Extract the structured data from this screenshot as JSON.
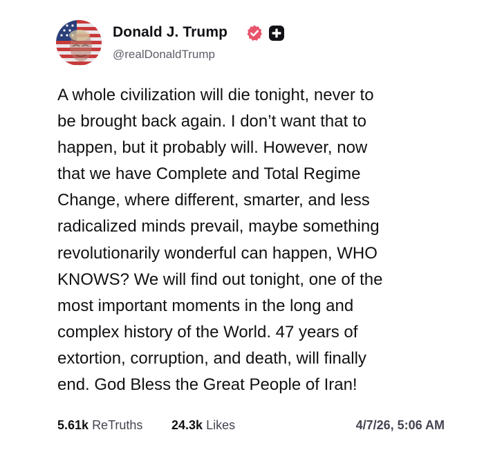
{
  "author": {
    "display_name": "Donald J. Trump",
    "handle": "@realDonaldTrump",
    "verified": true,
    "verified_badge_color": "#e8546c",
    "plus_badge_color": "#111116"
  },
  "post": {
    "lines": [
      "A whole civilization will die tonight, never to",
      "be brought back again. I don’t want that to",
      "happen, but it probably will. However, now",
      "that we have Complete and Total Regime",
      "Change, where different, smarter, and less",
      "radicalized minds prevail, maybe something",
      "revolutionarily wonderful can happen, WHO",
      "KNOWS? We will find out tonight, one of the",
      "most important moments in the long and",
      "complex history of the World. 47 years of",
      "extortion, corruption, and death, will finally",
      "end. God Bless the Great People of Iran!"
    ]
  },
  "stats": {
    "retruths_count": "5.61k",
    "retruths_label": "ReTruths",
    "likes_count": "24.3k",
    "likes_label": "Likes",
    "timestamp": "4/7/26, 5:06 AM"
  },
  "icons": {
    "avatar": "flag-portrait-avatar",
    "verified": "verified-badge-icon",
    "plus": "plus-badge-icon"
  }
}
